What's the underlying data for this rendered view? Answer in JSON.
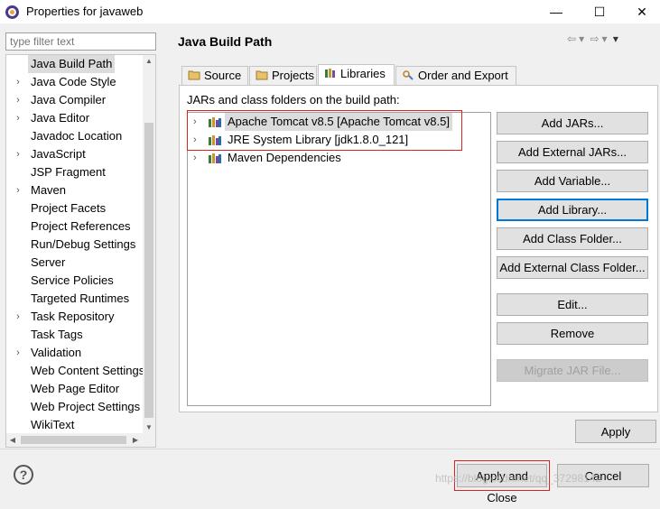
{
  "window": {
    "title": "Properties for javaweb",
    "minimize_glyph": "—",
    "maximize_glyph": "☐",
    "close_glyph": "✕"
  },
  "filter": {
    "placeholder": "type filter text"
  },
  "nav": {
    "items": [
      {
        "label": "Java Build Path",
        "expandable": false,
        "selected": true
      },
      {
        "label": "Java Code Style",
        "expandable": true
      },
      {
        "label": "Java Compiler",
        "expandable": true
      },
      {
        "label": "Java Editor",
        "expandable": true
      },
      {
        "label": "Javadoc Location",
        "expandable": false
      },
      {
        "label": "JavaScript",
        "expandable": true
      },
      {
        "label": "JSP Fragment",
        "expandable": false
      },
      {
        "label": "Maven",
        "expandable": true
      },
      {
        "label": "Project Facets",
        "expandable": false
      },
      {
        "label": "Project References",
        "expandable": false
      },
      {
        "label": "Run/Debug Settings",
        "expandable": false
      },
      {
        "label": "Server",
        "expandable": false
      },
      {
        "label": "Service Policies",
        "expandable": false
      },
      {
        "label": "Targeted Runtimes",
        "expandable": false
      },
      {
        "label": "Task Repository",
        "expandable": true
      },
      {
        "label": "Task Tags",
        "expandable": false
      },
      {
        "label": "Validation",
        "expandable": true
      },
      {
        "label": "Web Content Settings",
        "expandable": false
      },
      {
        "label": "Web Page Editor",
        "expandable": false
      },
      {
        "label": "Web Project Settings",
        "expandable": false
      },
      {
        "label": "WikiText",
        "expandable": false
      }
    ]
  },
  "page": {
    "title": "Java Build Path",
    "tabs": [
      {
        "label": "Source",
        "active": false
      },
      {
        "label": "Projects",
        "active": false
      },
      {
        "label": "Libraries",
        "active": true
      },
      {
        "label": "Order and Export",
        "active": false
      }
    ],
    "content_label": "JARs and class folders on the build path:",
    "libraries": [
      {
        "label": "Apache Tomcat v8.5 [Apache Tomcat v8.5]",
        "selected": true
      },
      {
        "label": "JRE System Library [jdk1.8.0_121]",
        "selected": false
      },
      {
        "label": "Maven Dependencies",
        "selected": false
      }
    ],
    "buttons": {
      "add_jars": "Add JARs...",
      "add_external_jars": "Add External JARs...",
      "add_variable": "Add Variable...",
      "add_library": "Add Library...",
      "add_class_folder": "Add Class Folder...",
      "add_external_class_folder": "Add External Class Folder...",
      "edit": "Edit...",
      "remove": "Remove",
      "migrate_jar": "Migrate JAR File..."
    },
    "apply": "Apply"
  },
  "footer": {
    "help_glyph": "?",
    "apply_and_close": "Apply and Close",
    "cancel": "Cancel",
    "watermark": "https://blog.csdn.net/qq_37298142"
  },
  "colors": {
    "highlight_box": "#e02020",
    "focus": "#0078d7"
  }
}
